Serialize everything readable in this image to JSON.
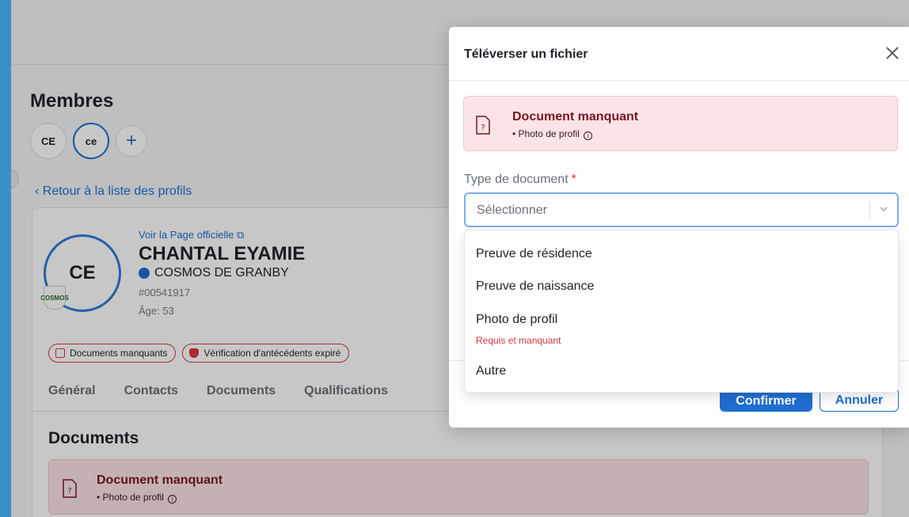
{
  "app": {
    "members_title": "Membres",
    "member_chips": [
      "CE",
      "ce"
    ],
    "add_label": "+",
    "back_link": "‹ Retour à la liste des profils",
    "profile": {
      "initials": "CE",
      "official_link": "Voir la Page officielle ⧉",
      "name": "CHANTAL EYAMIE",
      "team": "COSMOS DE GRANBY",
      "member_id": "#00541917",
      "age": "Âge: 53",
      "logo_text": "COSMOS"
    },
    "status_pills": [
      "Documents manquants",
      "Vérification d'antécédents expiré"
    ],
    "tabs": [
      "Général",
      "Contacts",
      "Documents",
      "Qualifications"
    ],
    "docs_title": "Documents",
    "docs_alert": {
      "title": "Document manquant",
      "item": "• Photo de profil"
    }
  },
  "modal": {
    "title": "Téléverser un fichier",
    "alert": {
      "title": "Document manquant",
      "item": "• Photo de profil"
    },
    "field_label": "Type de document",
    "required_mark": "*",
    "select_placeholder": "Sélectionner",
    "options": [
      {
        "label": "Preuve de résidence"
      },
      {
        "label": "Preuve de naissance"
      },
      {
        "label": "Photo de profil",
        "note": "Requis et manquant"
      },
      {
        "label": "Autre"
      }
    ],
    "confirm_label": "Confirmer",
    "cancel_label": "Annuler"
  },
  "colors": {
    "accent": "#1f6fd1",
    "danger": "#d9363e",
    "alert_bg": "#fbe4e6",
    "alert_title": "#7a1623"
  }
}
